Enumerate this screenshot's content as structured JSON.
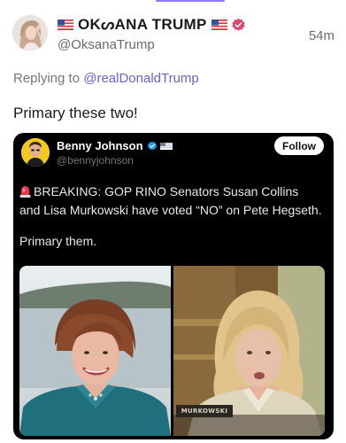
{
  "post": {
    "author_display_name": "OKᔕANA TRUMP",
    "author_handle": "@OksanaTrump",
    "timestamp": "54m",
    "replying_prefix": "Replying to",
    "replying_to": "@realDonaldTrump",
    "text": "Primary these two!",
    "avatar_icon": "profile-photo",
    "flag_icon": "us-flag-icon",
    "verified_icon": "verified-badge-icon",
    "verified_color": "#e2456b"
  },
  "embed": {
    "author_name": "Benny Johnson",
    "author_handle": "@bennyjohnson",
    "follow_label": "Follow",
    "body_line1": "BREAKING: GOP RINO Senators Susan Collins and Lisa Murkowski have voted “NO” on Pete Hegseth.",
    "body_line2": "Primary them.",
    "siren_icon": "siren-emoji-icon",
    "verified_color": "#1d9bf0",
    "photo_left": "photo-susan-collins",
    "photo_right": "photo-lisa-murkowski",
    "nameplate_text": "MURKOWSKI"
  },
  "colors": {
    "link": "#6c5fd6",
    "secondary_text": "#6b6b6b",
    "embed_background": "#000000"
  }
}
